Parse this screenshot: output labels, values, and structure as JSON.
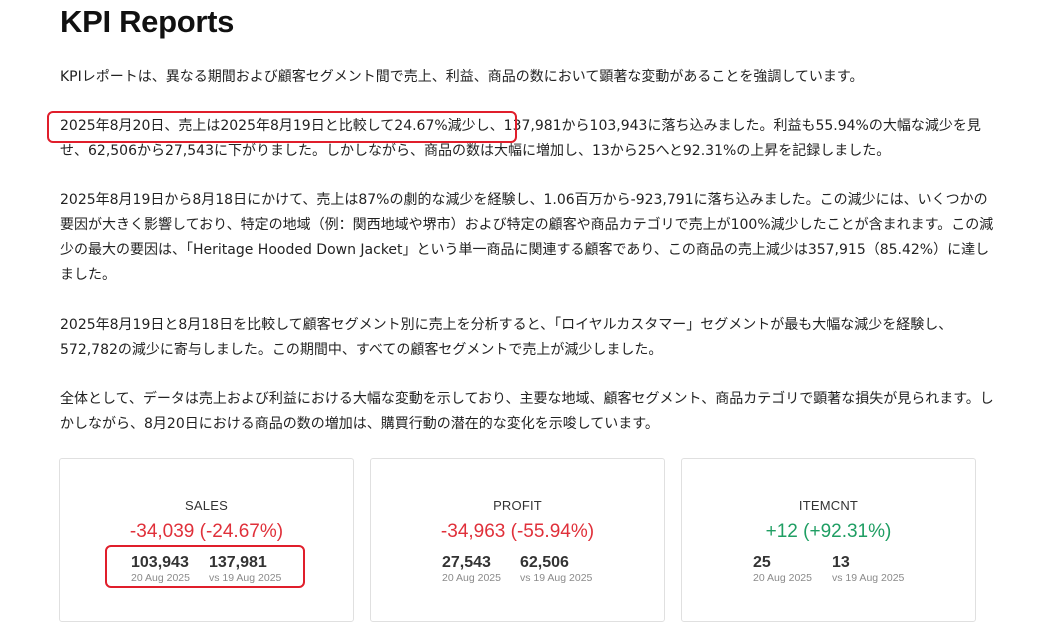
{
  "page": {
    "title": "KPI Reports"
  },
  "paragraphs": {
    "intro": "KPIレポートは、異なる期間および顧客セグメント間で売上、利益、商品の数において顕著な変動があることを強調しています。",
    "p2": "2025年8月20日、売上は2025年8月19日と比較して24.67%減少し、137,981から103,943に落ち込みました。利益も55.94%の大幅な減少を見せ、62,506から27,543に下がりました。しかしながら、商品の数は大幅に増加し、13から25へと92.31%の上昇を記録しました。",
    "p3": "2025年8月19日から8月18日にかけて、売上は87%の劇的な減少を経験し、1.06百万から-923,791に落ち込みました。この減少には、いくつかの要因が大きく影響しており、特定の地域（例：関西地域や堺市）および特定の顧客や商品カテゴリで売上が100%減少したことが含まれます。この減少の最大の要因は、「Heritage Hooded Down Jacket」という単一商品に関連する顧客であり、この商品の売上減少は357,915（85.42%）に達しました。",
    "p4": "2025年8月19日と8月18日を比較して顧客セグメント別に売上を分析すると、「ロイヤルカスタマー」セグメントが最も大幅な減少を経験し、572,782の減少に寄与しました。この期間中、すべての顧客セグメントで売上が減少しました。",
    "p5": "全体として、データは売上および利益における大幅な変動を示しており、主要な地域、顧客セグメント、商品カテゴリで顕著な損失が見られます。しかしながら、8月20日における商品の数の増加は、購買行動の潜在的な変化を示唆しています。"
  },
  "cards": [
    {
      "label": "SALES",
      "delta": "-34,039 (-24.67%)",
      "trend": "negative",
      "current_value": "103,943",
      "current_date": "20 Aug 2025",
      "previous_value": "137,981",
      "previous_date": "vs 19 Aug 2025"
    },
    {
      "label": "PROFIT",
      "delta": "-34,963 (-55.94%)",
      "trend": "negative",
      "current_value": "27,543",
      "current_date": "20 Aug 2025",
      "previous_value": "62,506",
      "previous_date": "vs 19 Aug 2025"
    },
    {
      "label": "ITEMCNT",
      "delta": "+12 (+92.31%)",
      "trend": "positive",
      "current_value": "25",
      "current_date": "20 Aug 2025",
      "previous_value": "13",
      "previous_date": "vs 19 Aug 2025"
    }
  ],
  "colors": {
    "negative": "#e0303a",
    "positive": "#1f9e63",
    "highlight_border": "#e01e2b"
  }
}
